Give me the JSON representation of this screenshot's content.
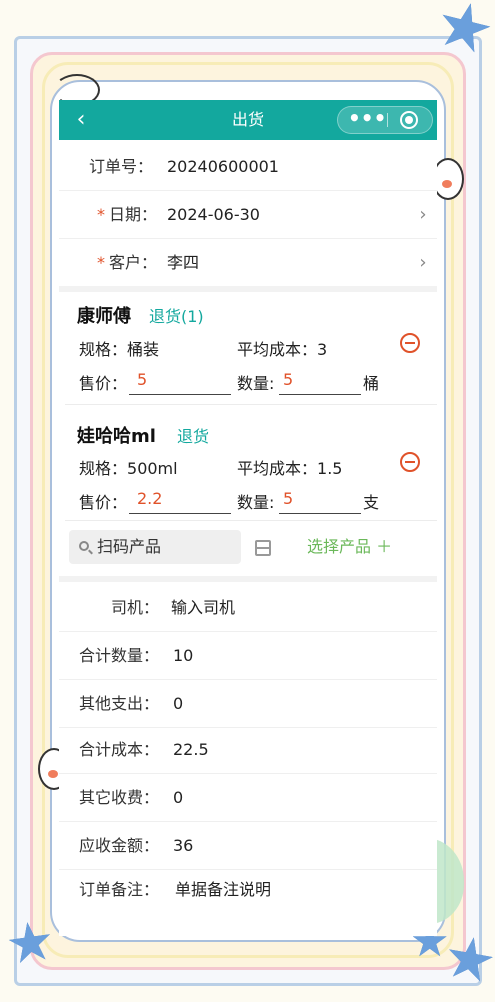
{
  "navbar": {
    "title": "出货",
    "back_icon": "chevron-left-icon",
    "more_icon": "more-dots-icon",
    "home_icon": "target-icon"
  },
  "order": {
    "order_no_label": "订单号：",
    "order_no": "20240600001",
    "date_label": "日期：",
    "date": "2024-06-30",
    "customer_label": "客户：",
    "customer": "李四",
    "required_mark": "*"
  },
  "products": [
    {
      "name": "康师傅",
      "return_label": "退货(1)",
      "spec_label": "规格：",
      "spec": "桶装",
      "avg_cost_label": "平均成本：",
      "avg_cost": "3",
      "price_label": "售价：",
      "price": "5",
      "qty_label": "数量:",
      "qty": "5",
      "unit": "桶"
    },
    {
      "name": "娃哈哈ml",
      "return_label": "退货",
      "spec_label": "规格：",
      "spec": "500ml",
      "avg_cost_label": "平均成本：",
      "avg_cost": "1.5",
      "price_label": "售价：",
      "price": "2.2",
      "qty_label": "数量:",
      "qty": "5",
      "unit": "支"
    }
  ],
  "actions": {
    "scan_placeholder": "扫码产品",
    "select_product": "选择产品 ＋"
  },
  "summary": {
    "driver_label": "司机：",
    "driver_placeholder": "输入司机",
    "total_qty_label": "合计数量：",
    "total_qty": "10",
    "other_expense_label": "其他支出：",
    "other_expense": "0",
    "total_cost_label": "合计成本：",
    "total_cost": "22.5",
    "other_fee_label": "其它收费：",
    "other_fee": "0",
    "receivable_label": "应收金额：",
    "receivable": "36",
    "remark_label": "订单备注：",
    "remark_placeholder": "单据备注说明"
  },
  "colors": {
    "header": "#13a89e",
    "accent_red": "#e0522a",
    "accent_green": "#6bb85a"
  }
}
